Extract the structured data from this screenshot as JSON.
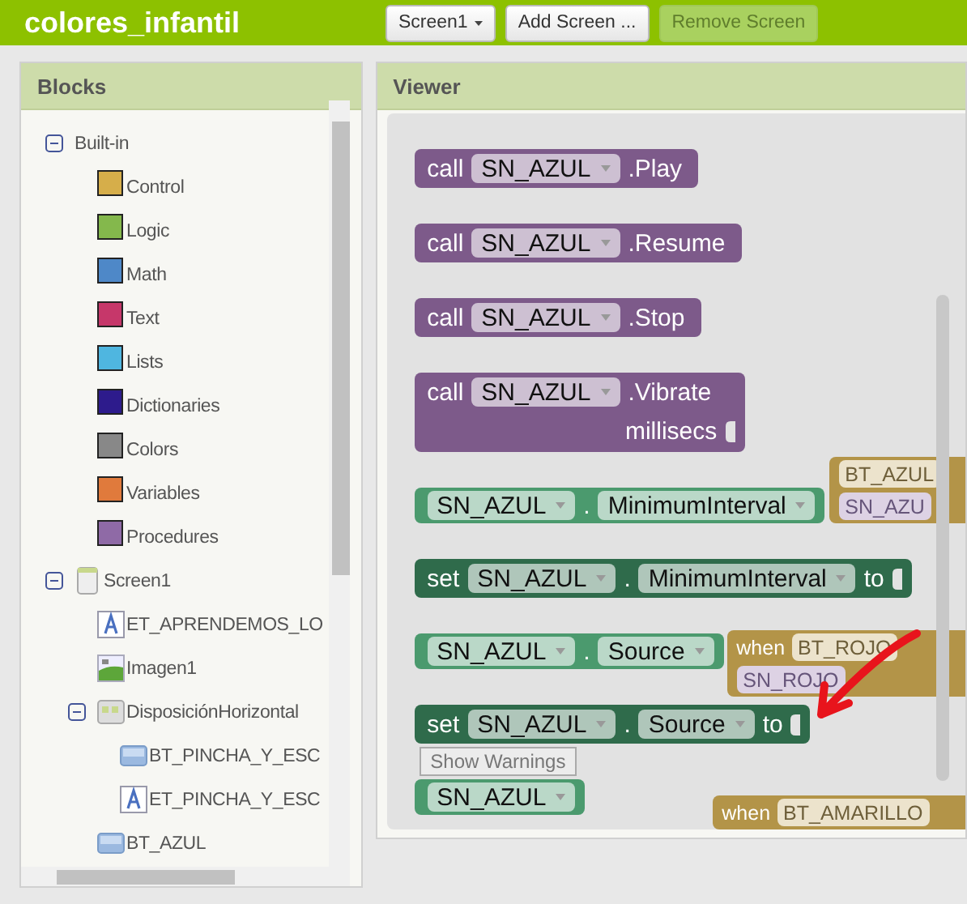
{
  "app": {
    "title": "colores_infantil"
  },
  "toolbar": {
    "screen_dropdown": "Screen1",
    "buttons": [
      {
        "label": "Add Screen ...",
        "disabled": false
      },
      {
        "label": "Remove Screen",
        "disabled": true
      }
    ]
  },
  "blocks_panel": {
    "title": "Blocks",
    "tree": [
      {
        "label": "Built-in",
        "kind": "group",
        "expanded": true,
        "children": [
          {
            "label": "Control",
            "kind": "category",
            "color": "#d6ae4a"
          },
          {
            "label": "Logic",
            "kind": "category",
            "color": "#84b84c"
          },
          {
            "label": "Math",
            "kind": "category",
            "color": "#4e88c8"
          },
          {
            "label": "Text",
            "kind": "category",
            "color": "#c6376a"
          },
          {
            "label": "Lists",
            "kind": "category",
            "color": "#4fb6e0"
          },
          {
            "label": "Dictionaries",
            "kind": "category",
            "color": "#2d1b8c"
          },
          {
            "label": "Colors",
            "kind": "category",
            "color": "#888888"
          },
          {
            "label": "Variables",
            "kind": "category",
            "color": "#e07a3c"
          },
          {
            "label": "Procedures",
            "kind": "category",
            "color": "#8f6aa6"
          }
        ]
      },
      {
        "label": "Screen1",
        "kind": "screen",
        "expanded": true,
        "children": [
          {
            "label": "ET_APRENDEMOS_LO",
            "kind": "label"
          },
          {
            "label": "Imagen1",
            "kind": "image"
          },
          {
            "label": "DisposiciónHorizontal",
            "kind": "arrangement",
            "expanded": true,
            "children": [
              {
                "label": "BT_PINCHA_Y_ESC",
                "kind": "button"
              },
              {
                "label": "ET_PINCHA_Y_ESC",
                "kind": "label"
              }
            ]
          },
          {
            "label": "BT_AZUL",
            "kind": "button"
          }
        ]
      }
    ]
  },
  "viewer": {
    "title": "Viewer",
    "workspace_blocks": [
      {
        "kind": "event",
        "component": "BT_AZUL",
        "action_component": "SN_AZU"
      },
      {
        "kind": "event",
        "keyword": "when",
        "component": "BT_ROJO",
        "action_component": "SN_ROJO"
      },
      {
        "kind": "event",
        "keyword": "when",
        "component": "BT_AMARILLO"
      }
    ],
    "show_warnings": "Show Warnings",
    "palette_blocks": [
      {
        "kind": "call",
        "keyword": "call",
        "component": "SN_AZUL",
        "member": ".Play"
      },
      {
        "kind": "call",
        "keyword": "call",
        "component": "SN_AZUL",
        "member": ".Resume"
      },
      {
        "kind": "call",
        "keyword": "call",
        "component": "SN_AZUL",
        "member": ".Stop"
      },
      {
        "kind": "call",
        "keyword": "call",
        "component": "SN_AZUL",
        "member": ".Vibrate",
        "argument": "millisecs"
      },
      {
        "kind": "getter",
        "component": "SN_AZUL",
        "dot": ".",
        "member": "MinimumInterval"
      },
      {
        "kind": "setter",
        "keyword": "set",
        "component": "SN_AZUL",
        "dot": ".",
        "member": "MinimumInterval",
        "to": "to"
      },
      {
        "kind": "getter",
        "component": "SN_AZUL",
        "dot": ".",
        "member": "Source"
      },
      {
        "kind": "setter",
        "keyword": "set",
        "component": "SN_AZUL",
        "dot": ".",
        "member": "Source",
        "to": "to"
      },
      {
        "kind": "component",
        "component": "SN_AZUL"
      }
    ]
  }
}
